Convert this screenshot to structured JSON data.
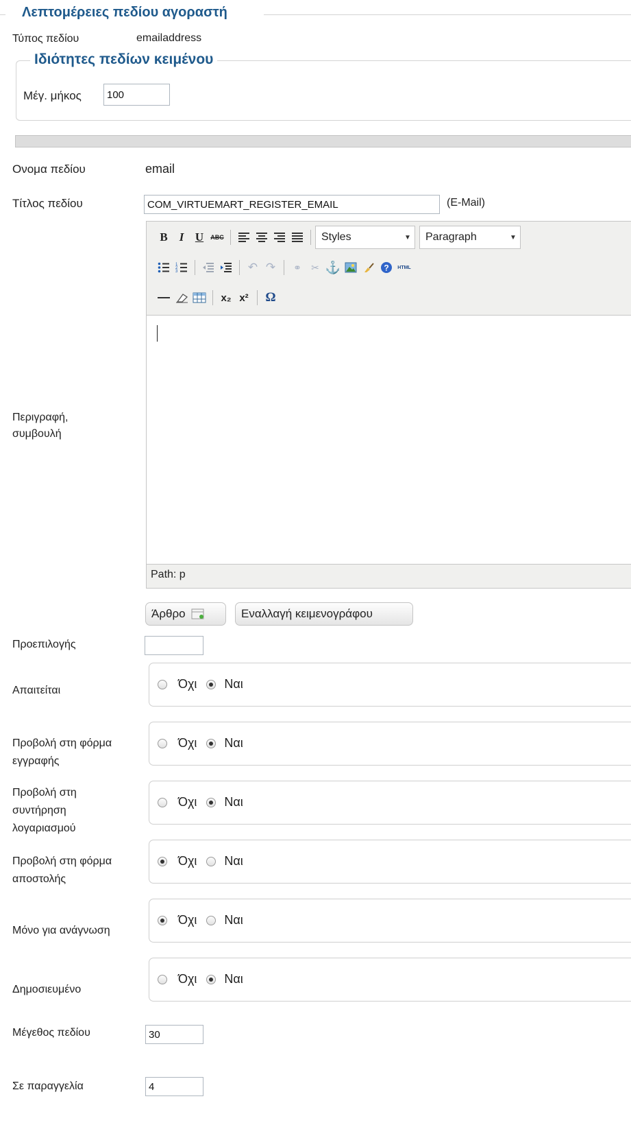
{
  "fieldset_main": {
    "legend": "Λεπτομέρειες πεδίου αγοραστή"
  },
  "field_type": {
    "label": "Τύπος πεδίου",
    "value": "emailaddress"
  },
  "fieldset_text": {
    "legend": "Ιδιότητες πεδίων κειμένου"
  },
  "max_length": {
    "label": "Μέγ. μήκος",
    "value": "100"
  },
  "field_name": {
    "label": "Ονομα πεδίου",
    "value": "email"
  },
  "field_title": {
    "label": "Τίτλος πεδίου",
    "value": "COM_VIRTUEMART_REGISTER_EMAIL",
    "translation": "(E-Mail)"
  },
  "description": {
    "label_line1": "Περιγραφή,",
    "label_line2": "συμβουλή"
  },
  "editor": {
    "styles_select": "Styles",
    "format_select": "Paragraph",
    "path_label": "Path: p",
    "icons": {
      "bold": "B",
      "italic": "I",
      "underline": "U",
      "strike": "ABC",
      "subscript": "x₂",
      "superscript": "x²",
      "special_char": "Ω",
      "html": "HTML"
    }
  },
  "buttons": {
    "article": "Άρθρο",
    "toggle_editor": "Εναλλαγή κειμενογράφου"
  },
  "default_value": {
    "label": "Προεπιλογής",
    "value": ""
  },
  "radio_options": {
    "no": "Όχι",
    "yes": "Ναι"
  },
  "radio_fields": [
    {
      "label_lines": [
        "Απαιτείται"
      ],
      "selected": "yes"
    },
    {
      "label_lines": [
        "Προβολή στη φόρμα",
        "εγγραφής"
      ],
      "selected": "yes"
    },
    {
      "label_lines": [
        "Προβολή στη",
        "συντήρηση",
        "λογαριασμού"
      ],
      "selected": "yes"
    },
    {
      "label_lines": [
        "Προβολή στη φόρμα",
        "αποστολής"
      ],
      "selected": "no"
    },
    {
      "label_lines": [
        "Μόνο για ανάγνωση"
      ],
      "selected": "no"
    },
    {
      "label_lines": [
        "Δημοσιευμένο"
      ],
      "selected": "yes"
    }
  ],
  "field_size": {
    "label": "Μέγεθος πεδίου",
    "value": "30"
  },
  "ordering": {
    "label": "Σε παραγγελία",
    "value": "4"
  }
}
